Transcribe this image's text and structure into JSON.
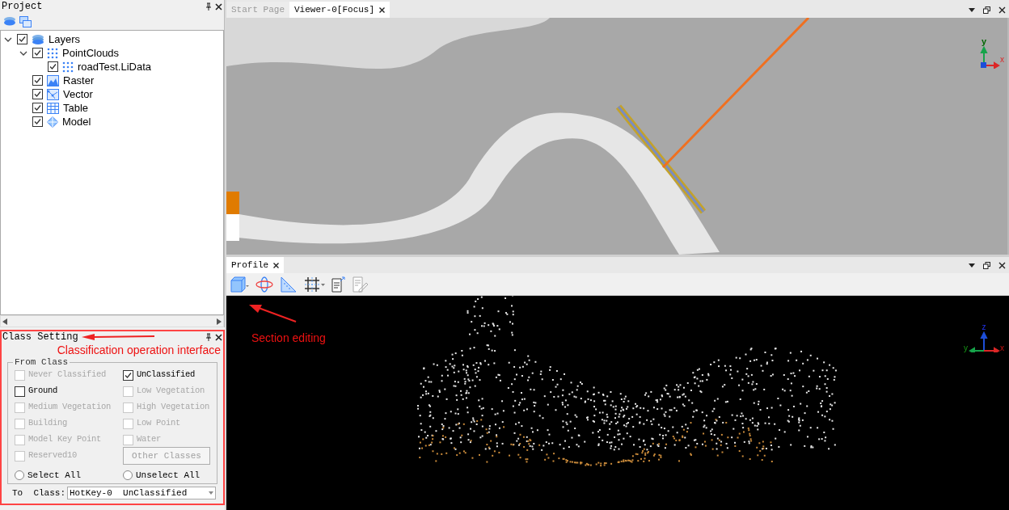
{
  "project_panel": {
    "title": "Project",
    "tree": [
      {
        "label": "Layers",
        "kind": "layers",
        "checked": true,
        "expanded": true,
        "children": [
          {
            "label": "PointClouds",
            "kind": "points",
            "checked": true,
            "expanded": true,
            "children": [
              {
                "label": "roadTest.LiData",
                "kind": "points",
                "checked": true
              }
            ]
          },
          {
            "label": "Raster",
            "kind": "raster",
            "checked": true
          },
          {
            "label": "Vector",
            "kind": "vector",
            "checked": true
          },
          {
            "label": "Table",
            "kind": "table",
            "checked": true
          },
          {
            "label": "Model",
            "kind": "model",
            "checked": true
          }
        ]
      }
    ]
  },
  "class_setting": {
    "title": "Class Setting",
    "annotation": "Classification operation interface",
    "group_title": "From Class",
    "classes": [
      {
        "label": "Never Classified",
        "checked": false,
        "disabled": true
      },
      {
        "label": "UnClassified",
        "checked": true,
        "disabled": false
      },
      {
        "label": "Ground",
        "checked": false,
        "disabled": false
      },
      {
        "label": "Low Vegetation",
        "checked": false,
        "disabled": true
      },
      {
        "label": "Medium Vegetation",
        "checked": false,
        "disabled": true
      },
      {
        "label": "High Vegetation",
        "checked": false,
        "disabled": true
      },
      {
        "label": "Building",
        "checked": false,
        "disabled": true
      },
      {
        "label": "Low Point",
        "checked": false,
        "disabled": true
      },
      {
        "label": "Model Key Point",
        "checked": false,
        "disabled": true
      },
      {
        "label": "Water",
        "checked": false,
        "disabled": true
      },
      {
        "label": "Reserved10",
        "checked": false,
        "disabled": true
      }
    ],
    "other_button": "Other Classes",
    "radios": [
      {
        "label": "Select All",
        "selected": false
      },
      {
        "label": "Unselect All",
        "selected": false
      }
    ],
    "to_class_label": "To  Class:",
    "to_class_value": "HotKey-0  UnClassified"
  },
  "viewer": {
    "tabs": [
      {
        "label": "Start Page",
        "selected": false,
        "closable": false
      },
      {
        "label": "Viewer-0[Focus]",
        "selected": true,
        "closable": true
      }
    ],
    "axes": [
      "y",
      "x"
    ]
  },
  "profile": {
    "tab": "Profile",
    "annotation": "Section editing",
    "axes": [
      "z",
      "y",
      "x"
    ]
  }
}
